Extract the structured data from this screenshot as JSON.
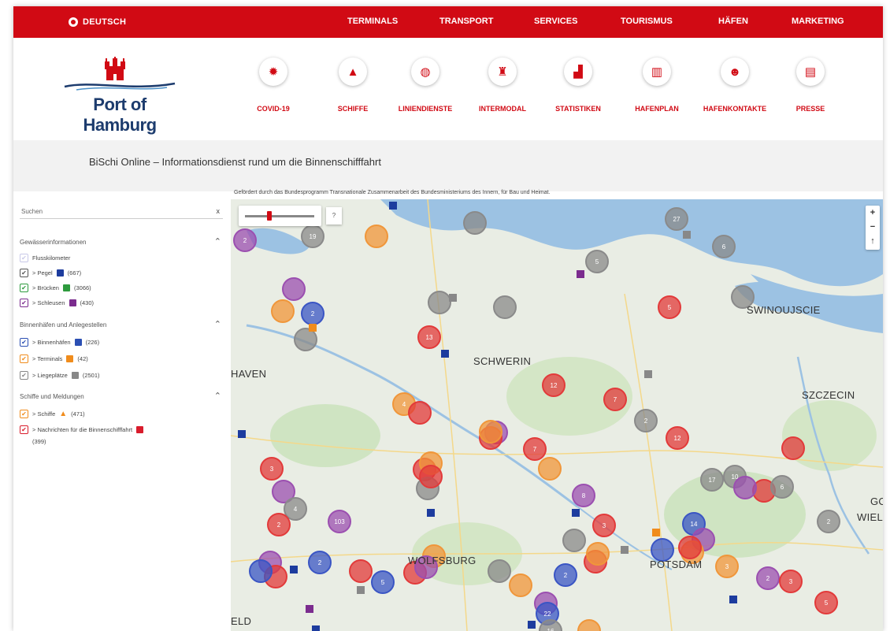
{
  "topbar": {
    "language": "DEUTSCH",
    "nav": [
      "TERMINALS",
      "TRANSPORT",
      "SERVICES",
      "TOURISMUS",
      "HÄFEN",
      "MARKETING"
    ]
  },
  "logo": {
    "name": "Port of Hamburg"
  },
  "header_icons": [
    {
      "label": "COVID-19",
      "icon": "virus-icon"
    },
    {
      "label": "SCHIFFE",
      "icon": "ship-icon"
    },
    {
      "label": "LINIENDIENSTE",
      "icon": "globe-icon"
    },
    {
      "label": "INTERMODAL",
      "icon": "train-icon"
    },
    {
      "label": "STATISTIKEN",
      "icon": "chart-icon"
    },
    {
      "label": "HAFENPLAN",
      "icon": "map-icon"
    },
    {
      "label": "HAFENKONTAKTE",
      "icon": "contact-icon"
    },
    {
      "label": "PRESSE",
      "icon": "newspaper-icon"
    }
  ],
  "page": {
    "title": "BiSchi Online – Informationsdienst rund um die Binnenschifffahrt",
    "funding": "Gefördert durch das Bundesprogramm Transnationale Zusammenarbeit des Bundesministeriums des Innern, für Bau und Heimat."
  },
  "sidebar": {
    "search_placeholder": "Suchen",
    "search_clear": "x",
    "sections": [
      {
        "title": "Gewässerinformationen",
        "items": [
          {
            "label": "Flusskilometer",
            "count": "",
            "color": "#c9c9e8",
            "checked": true
          },
          {
            "label": "> Pegel",
            "count": "(667)",
            "color": "#1d3c9e",
            "checked": true
          },
          {
            "label": "> Brücken",
            "count": "(3066)",
            "color": "#2e9b3e",
            "checked": true
          },
          {
            "label": "> Schleusen",
            "count": "(430)",
            "color": "#7b2c8e",
            "checked": true
          }
        ]
      },
      {
        "title": "Binnenhäfen und Anlegestellen",
        "items": [
          {
            "label": "> Binnenhäfen",
            "count": "(226)",
            "color": "#2b4fb3",
            "checked": true
          },
          {
            "label": "> Terminals",
            "count": "(42)",
            "color": "#f08c1c",
            "checked": true
          },
          {
            "label": "> Liegeplätze",
            "count": "(2501)",
            "color": "#888888",
            "checked": true
          }
        ]
      },
      {
        "title": "Schiffe und Meldungen",
        "items": [
          {
            "label": "> Schiffe",
            "count": "(471)",
            "color": "#f08c1c",
            "checked": true
          },
          {
            "label": "> Nachrichten für die Binnenschifffahrt",
            "count": "(399)",
            "color": "#d91c2c",
            "checked": true
          }
        ]
      }
    ]
  },
  "map": {
    "cities": [
      "SWINOUJSCIE",
      "SCHWERIN",
      "SZCZECIN",
      "HAVEN",
      "GOR",
      "WIELKO",
      "WOLFSBURG",
      "POTSDAM",
      "ELD"
    ],
    "zoom_in": "+",
    "zoom_out": "−",
    "help": "?",
    "cluster_labels": [
      "2",
      "19",
      "27",
      "6",
      "5",
      "2",
      "13",
      "5",
      "12",
      "4",
      "7",
      "2",
      "12",
      "7",
      "17",
      "10",
      "6",
      "3",
      "4",
      "103",
      "2",
      "8",
      "3",
      "14",
      "3",
      "2",
      "3",
      "2",
      "5",
      "2",
      "22",
      "16",
      "5",
      "2"
    ]
  }
}
